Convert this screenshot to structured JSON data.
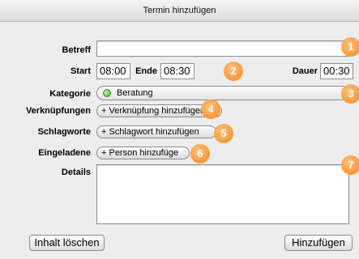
{
  "window": {
    "title": "Termin hinzufügen"
  },
  "form": {
    "subject_label": "Betreff",
    "subject_value": "",
    "start_label": "Start",
    "start_value": "08:00",
    "end_label": "Ende",
    "end_value": "08:30",
    "duration_label": "Dauer",
    "duration_value": "00:30",
    "category_label": "Kategorie",
    "category_value": "Beratung",
    "category_color": "#41b530",
    "links_label": "Verknüpfungen",
    "links_button": "+ Verknüpfung hinzufügen",
    "tags_label": "Schlagworte",
    "tags_button": "+ Schlagwort hinzufügen",
    "invitees_label": "Eingeladene",
    "invitees_button": "+ Person hinzufüge",
    "details_label": "Details",
    "details_value": ""
  },
  "buttons": {
    "clear": "Inhalt löschen",
    "add": "Hinzufügen"
  },
  "badges": [
    "1",
    "2",
    "3",
    "4",
    "5",
    "6",
    "7"
  ],
  "colors": {
    "badge": "#f08a1e"
  }
}
